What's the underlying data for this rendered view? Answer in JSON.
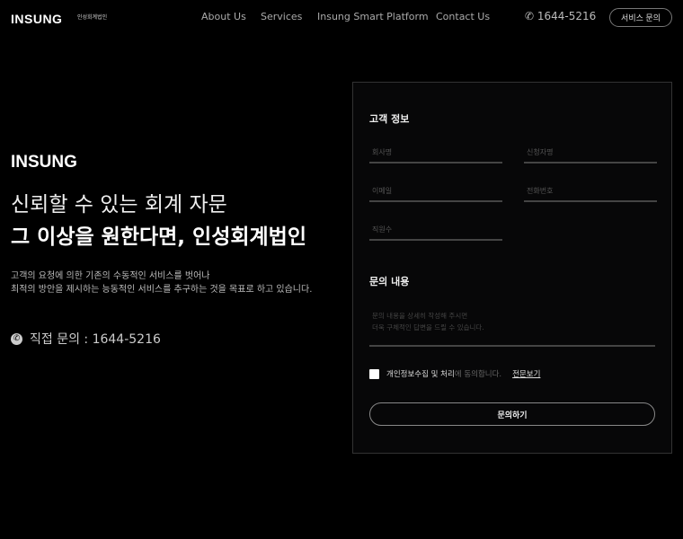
{
  "header": {
    "logo": "INSUNG",
    "logo_sub": "인성회계법인",
    "nav": [
      "About Us",
      "Services",
      "Insung Smart Platform",
      "Contact Us"
    ],
    "phone": "1644-5216",
    "cta": "서비스 문의"
  },
  "hero": {
    "logo": "INSUNG",
    "title_line1": "신뢰할 수 있는 회계 자문",
    "title_line2": "그 이상을 원한다면, 인성회계법인",
    "desc_line1": "고객의 요청에 의한 기존의 수동적인 서비스를 벗어나",
    "desc_line2": "최적의 방안을 제시하는 능동적인 서비스를 추구하는 것을 목표로 하고 있습니다.",
    "contact": "직접 문의 : 1644-5216"
  },
  "form": {
    "customer_title": "고객 정보",
    "company": "회사명",
    "applicant": "신청자명",
    "email": "이메일",
    "phone": "전화번호",
    "employees": "직원수",
    "inquiry_title": "문의 내용",
    "inquiry_placeholder": "문의 내용을 상세히 작성해 주시면\n더욱 구체적인 답변을 드릴 수 있습니다.",
    "consent_strong": "개인정보수집 및 처리",
    "consent_rest": "에 동의합니다.",
    "view_full": "전문보기",
    "submit": "문의하기"
  }
}
